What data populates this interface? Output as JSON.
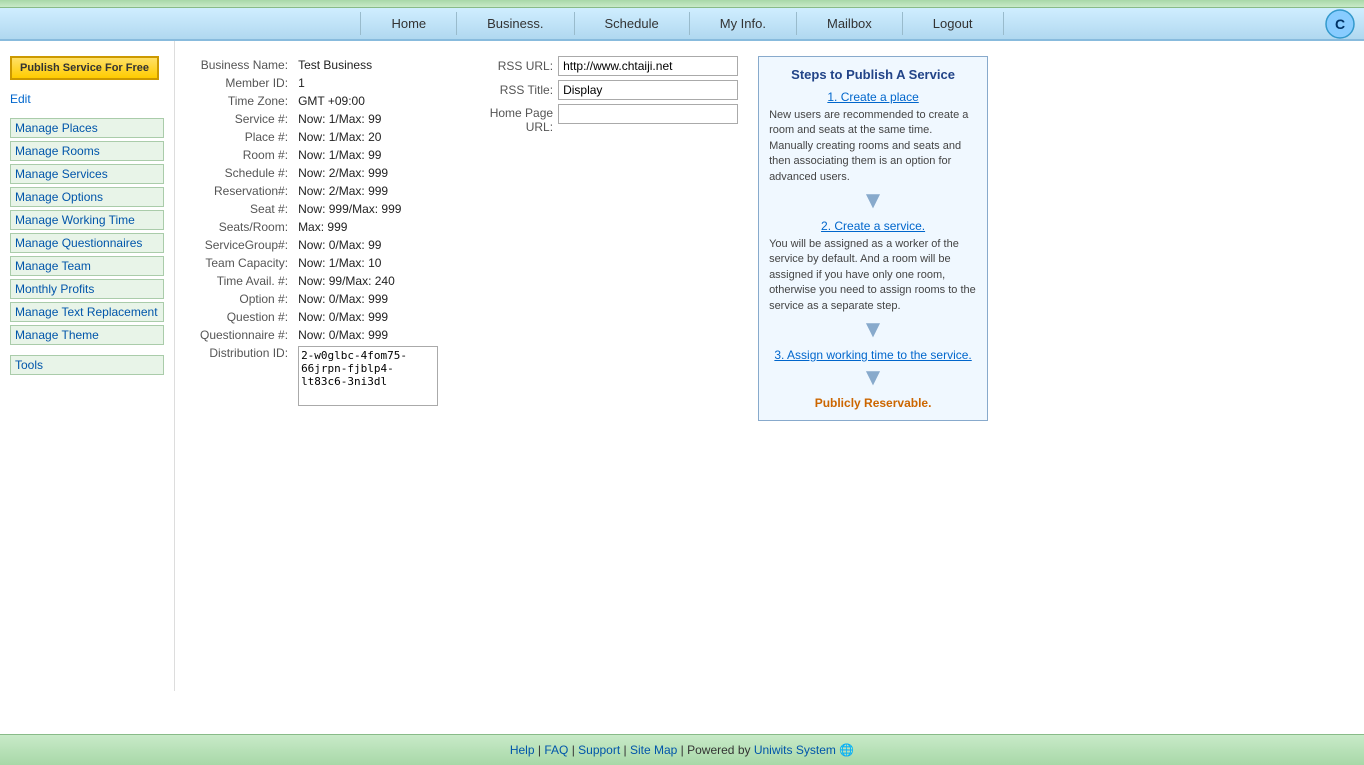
{
  "topbar": {},
  "nav": {
    "items": [
      {
        "label": "Home",
        "id": "home"
      },
      {
        "label": "Business.",
        "id": "business"
      },
      {
        "label": "Schedule",
        "id": "schedule"
      },
      {
        "label": "My Info.",
        "id": "myinfo"
      },
      {
        "label": "Mailbox",
        "id": "mailbox"
      },
      {
        "label": "Logout",
        "id": "logout"
      }
    ]
  },
  "sidebar": {
    "publish_btn": "Publish Service For Free",
    "edit_label": "Edit",
    "links": [
      {
        "label": "Manage Places",
        "id": "manage-places"
      },
      {
        "label": "Manage Rooms",
        "id": "manage-rooms"
      },
      {
        "label": "Manage Services",
        "id": "manage-services"
      },
      {
        "label": "Manage Options",
        "id": "manage-options"
      },
      {
        "label": "Manage Working Time",
        "id": "manage-working-time"
      },
      {
        "label": "Manage Questionnaires",
        "id": "manage-questionnaires"
      },
      {
        "label": "Manage Team",
        "id": "manage-team"
      },
      {
        "label": "Monthly Profits",
        "id": "monthly-profits"
      },
      {
        "label": "Manage Text Replacement",
        "id": "manage-text-replacement"
      },
      {
        "label": "Manage Theme",
        "id": "manage-theme"
      }
    ],
    "tools_label": "Tools"
  },
  "business_info": {
    "fields": [
      {
        "label": "Business Name:",
        "value": "Test Business"
      },
      {
        "label": "Member ID:",
        "value": "1"
      },
      {
        "label": "Time Zone:",
        "value": "GMT +09:00"
      },
      {
        "label": "Service #:",
        "value": "Now: 1/Max: 99"
      },
      {
        "label": "Place #:",
        "value": "Now: 1/Max: 20"
      },
      {
        "label": "Room #:",
        "value": "Now: 1/Max: 99"
      },
      {
        "label": "Schedule #:",
        "value": "Now: 2/Max: 999"
      },
      {
        "label": "Reservation#:",
        "value": "Now: 2/Max: 999"
      },
      {
        "label": "Seat #:",
        "value": "Now: 999/Max: 999"
      },
      {
        "label": "Seats/Room:",
        "value": "Max: 999"
      },
      {
        "label": "ServiceGroup#:",
        "value": "Now: 0/Max: 99"
      },
      {
        "label": "Team Capacity:",
        "value": "Now: 1/Max: 10"
      },
      {
        "label": "Time Avail. #:",
        "value": "Now: 99/Max: 240"
      },
      {
        "label": "Option #:",
        "value": "Now: 0/Max: 999"
      },
      {
        "label": "Question #:",
        "value": "Now: 0/Max: 999"
      },
      {
        "label": "Questionnaire #:",
        "value": "Now: 0/Max: 999"
      },
      {
        "label": "Distribution ID:",
        "value": "2-w0glbc-4fom75-66jrpn-fjblp4-lt83c6-3ni3dl"
      }
    ]
  },
  "rss": {
    "rss_url_label": "RSS URL:",
    "rss_url_value": "http://www.chtaiji.net",
    "rss_title_label": "RSS Title:",
    "rss_title_value": "Display",
    "home_page_url_label": "Home Page URL:",
    "home_page_url_value": ""
  },
  "steps": {
    "title": "Steps to Publish A Service",
    "step1_title": "1. Create a place",
    "step1_desc": "New users are recommended to create a room and seats at the same time. Manually creating rooms and seats and then associating them is an option for advanced users.",
    "step2_title": "2. Create a service.",
    "step2_desc": "You will be assigned as a worker of the service by default. And a room will be assigned if you have only one room, otherwise you need to assign rooms to the service as a separate step.",
    "step3_title": "3. Assign working time to the service.",
    "final": "Publicly Reservable."
  },
  "footer": {
    "help": "Help",
    "faq": "FAQ",
    "support": "Support",
    "sitemap": "Site Map",
    "powered_by": "| Powered by",
    "company": "Uniwits System"
  }
}
